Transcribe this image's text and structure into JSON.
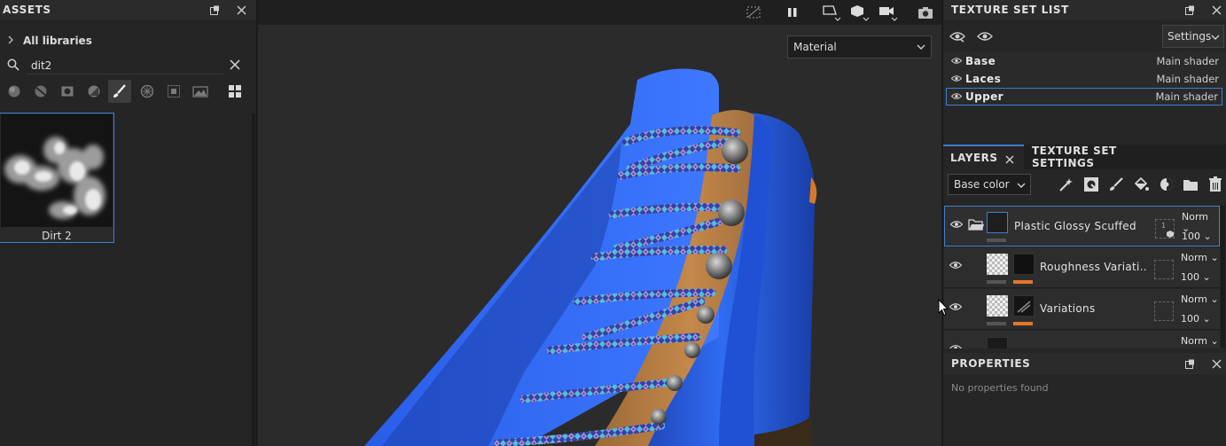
{
  "assets": {
    "title": "ASSETS",
    "library": "All libraries",
    "search_value": "dit2",
    "filters": [
      "smart-material-icon",
      "material-icon",
      "mask-icon",
      "generator-icon",
      "brush-icon",
      "particles-icon",
      "alpha-icon",
      "environment-icon",
      "grid-view-icon"
    ],
    "items": [
      {
        "label": "Dirt 2"
      }
    ]
  },
  "viewport": {
    "dropdown": "Material",
    "tools": [
      "hide-ui-icon",
      "pause-icon",
      "projection-icon",
      "view-cube-icon",
      "camera-icon",
      "screenshot-icon"
    ]
  },
  "texture_set_list": {
    "title": "TEXTURE SET LIST",
    "settings_label": "Settings",
    "sets": [
      {
        "name": "Base",
        "shader": "Main shader"
      },
      {
        "name": "Laces",
        "shader": "Main shader"
      },
      {
        "name": "Upper",
        "shader": "Main shader",
        "selected": true
      }
    ]
  },
  "layers": {
    "tab_layers": "LAYERS",
    "tab_settings": "TEXTURE SET SETTINGS",
    "channel": "Base color",
    "rows": [
      {
        "name": "Plastic Glossy Scuffed",
        "blend": "Norm",
        "opacity": "100",
        "type": "folder"
      },
      {
        "name": "Roughness Variati…",
        "blend": "Norm",
        "opacity": "100",
        "type": "fill"
      },
      {
        "name": "Variations",
        "blend": "Norm",
        "opacity": "100",
        "type": "fill"
      },
      {
        "name": "",
        "blend": "Norm",
        "opacity": "",
        "type": "fill"
      }
    ]
  },
  "properties": {
    "title": "PROPERTIES",
    "empty_text": "No properties found"
  },
  "colors": {
    "accent": "#3d7fd1",
    "orange": "#e0782a"
  }
}
